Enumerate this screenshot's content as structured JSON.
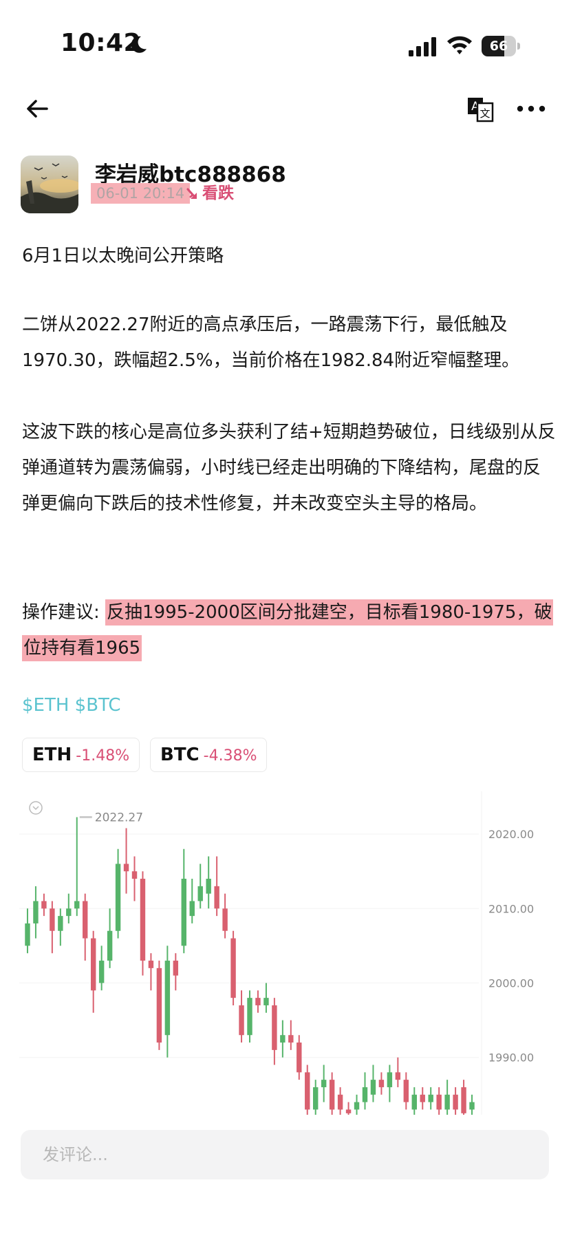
{
  "status_bar": {
    "time": "10:42",
    "battery": "66",
    "battery_level": 0.66,
    "icons": [
      "moon-icon",
      "signal-icon",
      "wifi-icon",
      "battery-icon"
    ]
  },
  "nav": {
    "icons": [
      "back-arrow-icon",
      "translate-icon",
      "more-icon"
    ]
  },
  "post": {
    "author": "李岩威btc888868",
    "time": "06-01 20:14",
    "sentiment": "看跌",
    "paragraphs": {
      "p1": "6月1日以太晚间公开策略",
      "p2": "二饼从2022.27附近的高点承压后，一路震荡下行，最低触及1970.30，跌幅超2.5%，当前价格在1982.84附近窄幅整理。",
      "p3": "这波下跌的核心是高位多头获利了结+短期趋势破位，日线级别从反弹通道转为震荡偏弱，小时线已经走出明确的下降结构，尾盘的反弹更偏向下跌后的技术性修复，并未改变空头主导的格局。",
      "p4_prefix": "操作建议: ",
      "p4_highlight": "反抽1995-2000区间分批建空，目标看1980-1975，破位持有看1965"
    },
    "hashtags": {
      "eth": "$ETH",
      "btc": "$BTC"
    }
  },
  "tickers": [
    {
      "symbol": "ETH",
      "change": "-1.48%"
    },
    {
      "symbol": "BTC",
      "change": "-4.38%"
    }
  ],
  "colors": {
    "up": "#56b46a",
    "down": "#d9606f",
    "accent": "#d94f75",
    "hashtag": "#5bc3cf",
    "highlight": "#f6aab1"
  },
  "chart_data": {
    "type": "candlestick",
    "high_label": "2022.27",
    "y_ticks": [
      "2020.00",
      "2010.00",
      "2000.00",
      "1990.00"
    ],
    "y_tick_values": [
      2020,
      2010,
      2000,
      1990
    ],
    "ylim": [
      1982.3,
      2025
    ],
    "grid": true,
    "candles": [
      {
        "o": 2005,
        "c": 2008,
        "h": 2010,
        "l": 2004
      },
      {
        "o": 2008,
        "c": 2011,
        "h": 2013,
        "l": 2006
      },
      {
        "o": 2011,
        "c": 2010,
        "h": 2012,
        "l": 2009
      },
      {
        "o": 2010,
        "c": 2007,
        "h": 2011,
        "l": 2004
      },
      {
        "o": 2007,
        "c": 2009,
        "h": 2010,
        "l": 2005
      },
      {
        "o": 2009,
        "c": 2010,
        "h": 2012,
        "l": 2008
      },
      {
        "o": 2010,
        "c": 2011,
        "h": 2022.27,
        "l": 2009
      },
      {
        "o": 2011,
        "c": 2006,
        "h": 2012,
        "l": 2003
      },
      {
        "o": 2006,
        "c": 1999,
        "h": 2007,
        "l": 1996
      },
      {
        "o": 2000,
        "c": 2003,
        "h": 2005,
        "l": 1999
      },
      {
        "o": 2003,
        "c": 2007,
        "h": 2010,
        "l": 2002
      },
      {
        "o": 2007,
        "c": 2016,
        "h": 2018,
        "l": 2006
      },
      {
        "o": 2016,
        "c": 2015,
        "h": 2020.8,
        "l": 2012
      },
      {
        "o": 2015,
        "c": 2014,
        "h": 2017,
        "l": 2011
      },
      {
        "o": 2014,
        "c": 2003,
        "h": 2015,
        "l": 2001
      },
      {
        "o": 2003,
        "c": 2002,
        "h": 2004,
        "l": 1999
      },
      {
        "o": 2002,
        "c": 1992,
        "h": 2003,
        "l": 1991
      },
      {
        "o": 1993,
        "c": 2003,
        "h": 2005,
        "l": 1990
      },
      {
        "o": 2003,
        "c": 2001,
        "h": 2004,
        "l": 1999
      },
      {
        "o": 2005,
        "c": 2014,
        "h": 2018,
        "l": 2004
      },
      {
        "o": 2009,
        "c": 2011,
        "h": 2014,
        "l": 2008
      },
      {
        "o": 2011,
        "c": 2013,
        "h": 2016,
        "l": 2010
      },
      {
        "o": 2012,
        "c": 2014,
        "h": 2017,
        "l": 2010
      },
      {
        "o": 2013,
        "c": 2010,
        "h": 2017,
        "l": 2009
      },
      {
        "o": 2010,
        "c": 2007,
        "h": 2012,
        "l": 2006
      },
      {
        "o": 2006,
        "c": 1998,
        "h": 2007,
        "l": 1997
      },
      {
        "o": 1997,
        "c": 1993,
        "h": 1999,
        "l": 1992
      },
      {
        "o": 1993,
        "c": 1998,
        "h": 1999,
        "l": 1992
      },
      {
        "o": 1998,
        "c": 1997,
        "h": 1999,
        "l": 1996
      },
      {
        "o": 1997,
        "c": 1998,
        "h": 2000,
        "l": 1996
      },
      {
        "o": 1997,
        "c": 1991,
        "h": 1998,
        "l": 1989
      },
      {
        "o": 1992,
        "c": 1993,
        "h": 1995,
        "l": 1990
      },
      {
        "o": 1993,
        "c": 1992,
        "h": 1995,
        "l": 1991
      },
      {
        "o": 1992,
        "c": 1988,
        "h": 1993,
        "l": 1987
      },
      {
        "o": 1988,
        "c": 1983,
        "h": 1989,
        "l": 1982
      },
      {
        "o": 1983,
        "c": 1986,
        "h": 1987,
        "l": 1982
      },
      {
        "o": 1986,
        "c": 1987,
        "h": 1989,
        "l": 1984
      },
      {
        "o": 1987,
        "c": 1983,
        "h": 1988,
        "l": 1982
      },
      {
        "o": 1985,
        "c": 1983,
        "h": 1986,
        "l": 1982
      },
      {
        "o": 1983,
        "c": 1982.5,
        "h": 1984,
        "l": 1982
      },
      {
        "o": 1983,
        "c": 1984,
        "h": 1985,
        "l": 1982
      },
      {
        "o": 1984,
        "c": 1986,
        "h": 1988,
        "l": 1983
      },
      {
        "o": 1985,
        "c": 1987,
        "h": 1989,
        "l": 1984
      },
      {
        "o": 1987,
        "c": 1986,
        "h": 1988,
        "l": 1985
      },
      {
        "o": 1986,
        "c": 1988,
        "h": 1989,
        "l": 1984
      },
      {
        "o": 1988,
        "c": 1987,
        "h": 1990,
        "l": 1986
      },
      {
        "o": 1987,
        "c": 1984,
        "h": 1988,
        "l": 1983
      },
      {
        "o": 1983,
        "c": 1985,
        "h": 1986,
        "l": 1982
      },
      {
        "o": 1985,
        "c": 1984,
        "h": 1986,
        "l": 1983
      },
      {
        "o": 1984,
        "c": 1985,
        "h": 1986,
        "l": 1983
      },
      {
        "o": 1985,
        "c": 1983,
        "h": 1986,
        "l": 1982
      },
      {
        "o": 1983,
        "c": 1985,
        "h": 1987,
        "l": 1982
      },
      {
        "o": 1985,
        "c": 1983,
        "h": 1986,
        "l": 1982
      },
      {
        "o": 1986,
        "c": 1982.5,
        "h": 1987,
        "l": 1982
      },
      {
        "o": 1983,
        "c": 1984,
        "h": 1985,
        "l": 1982
      }
    ]
  },
  "comment": {
    "placeholder": "发评论..."
  }
}
